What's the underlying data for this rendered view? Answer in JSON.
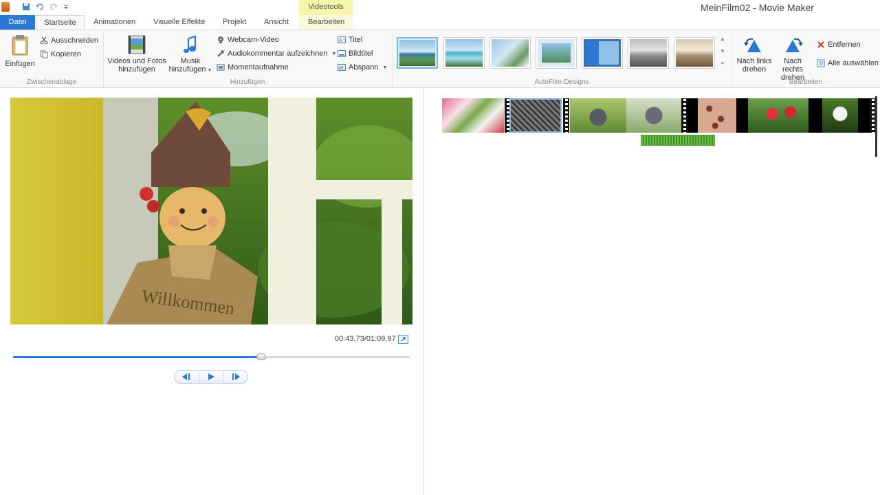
{
  "window": {
    "title": "MeinFilm02 - Movie Maker",
    "contextual_header": "Videotools"
  },
  "tabs": {
    "file": "Datei",
    "home": "Startseite",
    "animations": "Animationen",
    "visual_effects": "Visuelle Effekte",
    "project": "Projekt",
    "view": "Ansicht",
    "edit": "Bearbeiten"
  },
  "ribbon": {
    "clipboard": {
      "paste": "Einfügen",
      "cut": "Ausschneiden",
      "copy": "Kopieren",
      "group_label": "Zwischenablage"
    },
    "add": {
      "videos_photos_line1": "Videos und Fotos",
      "videos_photos_line2": "hinzufügen",
      "music_line1": "Musik",
      "music_line2": "hinzufügen",
      "webcam": "Webcam-Video",
      "narration": "Audiokommentar aufzeichnen",
      "snapshot": "Momentaufnahme",
      "title": "Titel",
      "caption": "Bildtitel",
      "credits": "Abspann",
      "group_label": "Hinzufügen"
    },
    "themes": {
      "group_label": "AutoFilm-Designs",
      "selected_index": 0
    },
    "editing": {
      "rotate_left_line1": "Nach links",
      "rotate_left_line2": "drehen",
      "rotate_right_line1": "Nach rechts",
      "rotate_right_line2": "drehen",
      "remove": "Entfernen",
      "select_all": "Alle auswählen",
      "group_label": "Bearbeiten"
    }
  },
  "preview": {
    "time": "00:43,73/01:09,97",
    "progress": 0.625
  },
  "colors": {
    "accent": "#2b78d6",
    "contextual": "#f6f5a8"
  }
}
